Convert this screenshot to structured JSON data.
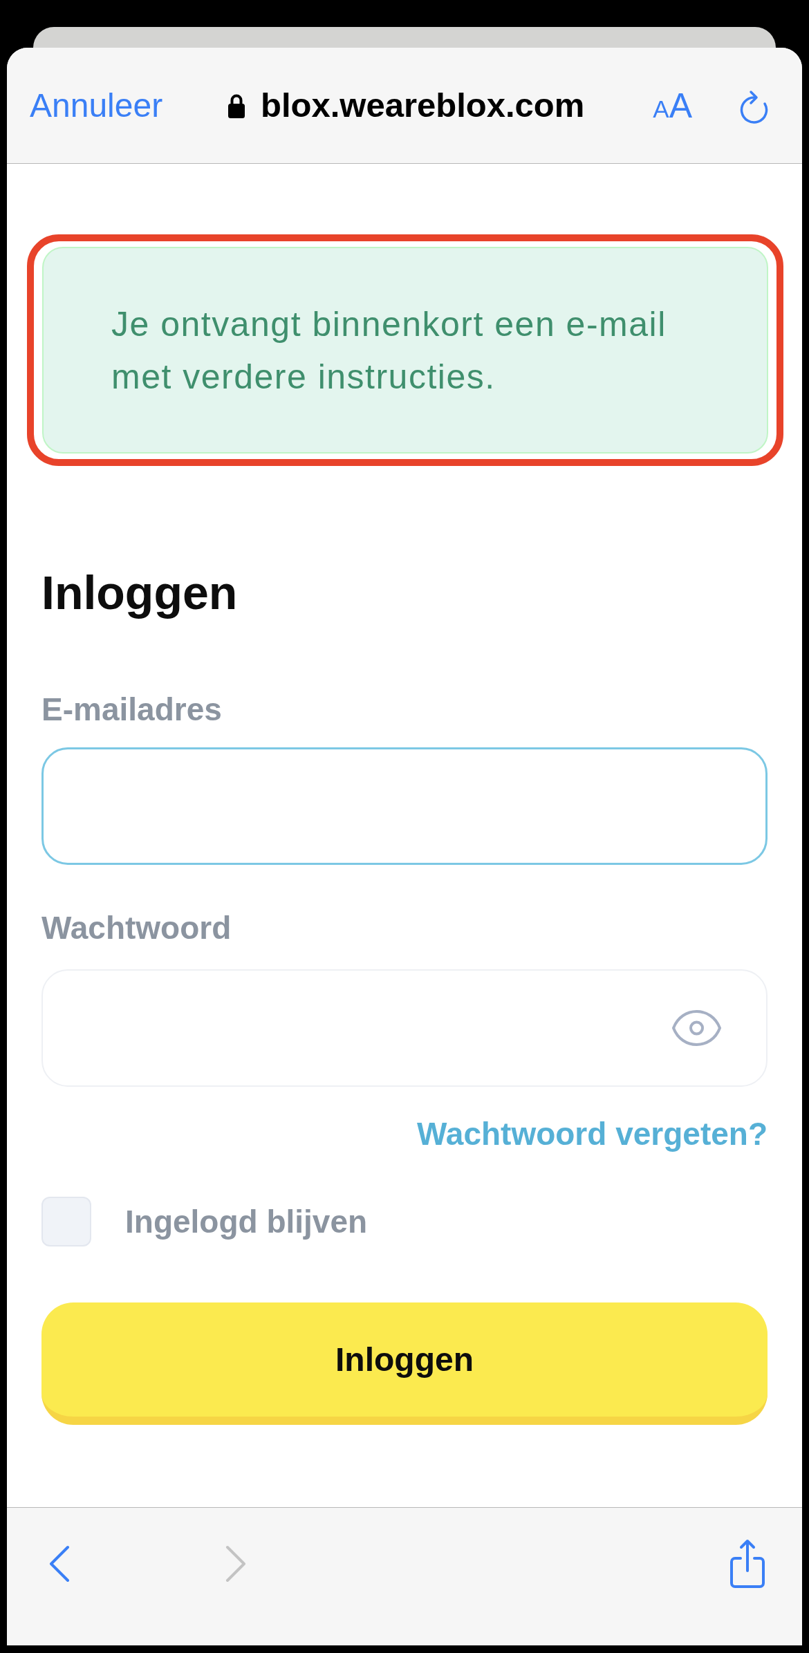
{
  "browser_bar": {
    "cancel": "Annuleer",
    "url": "blox.weareblox.com",
    "text_size_letters": [
      "A",
      "A"
    ]
  },
  "alert": {
    "message": "Je ontvangt binnenkort een e-mail met verdere instructies.",
    "highlighted": true
  },
  "login": {
    "title": "Inloggen",
    "fields": [
      {
        "kind": "email",
        "label": "E-mailadres",
        "focused": true
      },
      {
        "kind": "password",
        "label": "Wachtwoord",
        "focused": false
      }
    ],
    "forgot_link": "Wachtwoord vergeten?",
    "remember": {
      "label": "Ingelogd blijven",
      "checked": false
    },
    "submit": "Inloggen"
  },
  "toolbar": {
    "nav": [
      {
        "kind": "back",
        "disabled": false
      },
      {
        "kind": "forward",
        "disabled": true
      }
    ]
  }
}
